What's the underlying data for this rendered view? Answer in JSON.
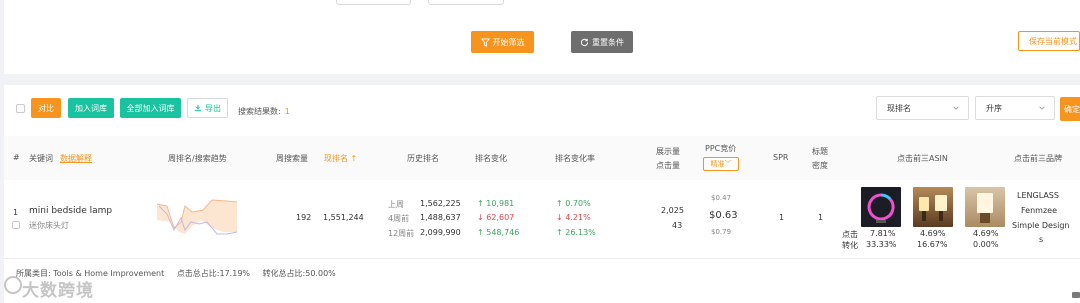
{
  "top": {
    "start_filter": "开始筛选",
    "reset": "重置条件",
    "save_template": "保存当前模式"
  },
  "toolbar": {
    "compare": "对比",
    "add_to_library": "加入词库",
    "add_all_to_library": "全部加入词库",
    "export": "导出",
    "result_label": "搜索结果数:",
    "result_count": "1",
    "sort_field": "现排名",
    "sort_order": "升序",
    "confirm": "确定"
  },
  "columns": {
    "index": "#",
    "keyword": "关键词",
    "data_explain": "数据解释",
    "weekly_trend": "周排名/搜索趋势",
    "weekly_search_volume": "周搜索量",
    "current_rank": "现排名",
    "history_rank": "历史排名",
    "rank_change": "排名变化",
    "rank_change_rate": "排名变化率",
    "impressions": "展示量",
    "clicks": "点击量",
    "ppc_bid": "PPC竞价",
    "ppc_mode": "精准",
    "spr": "SPR",
    "title_density_1": "标题",
    "title_density_2": "密度",
    "top3_asin": "点击前三ASIN",
    "top3_brand": "点击前三品牌"
  },
  "row": {
    "index": "1",
    "keyword": "mini bedside lamp",
    "keyword_cn": "迷你床头灯",
    "weekly_search_volume": "192",
    "current_rank": "1,551,244",
    "history": [
      {
        "label": "上周",
        "value": "1,562,225",
        "change": "10,981",
        "change_dir": "up",
        "rate": "0.70%",
        "rate_dir": "up"
      },
      {
        "label": "4周前",
        "value": "1,488,637",
        "change": "62,607",
        "change_dir": "down",
        "rate": "4.21%",
        "rate_dir": "down"
      },
      {
        "label": "12周前",
        "value": "2,099,990",
        "change": "548,746",
        "change_dir": "up",
        "rate": "26.13%",
        "rate_dir": "up"
      }
    ],
    "impressions": "2,025",
    "clicks": "43",
    "ppc_high": "$0.47",
    "ppc_mid": "$0.63",
    "ppc_low": "$0.79",
    "spr": "1",
    "title_density": "1",
    "asin_click_label": "点击",
    "asin_conv_label": "转化",
    "asins": [
      {
        "click": "7.81%",
        "conversion": "33.33%"
      },
      {
        "click": "4.69%",
        "conversion": "16.67%"
      },
      {
        "click": "4.69%",
        "conversion": "0.00%"
      }
    ],
    "brands_line1": "LENGLASS",
    "brands_line2": "Fenmzee",
    "brands_line3": "Simple Design",
    "brands_line4": "s"
  },
  "footer": {
    "category": "所属类目: Tools & Home Improvement",
    "click_share": "点击总占比:17.19%",
    "conversion_share": "转化总占比:50.00%"
  },
  "watermark": "大数跨境",
  "colors": {
    "accent_orange": "#f7941d",
    "teal": "#19c39f",
    "up_green": "#3ba55c",
    "down_red": "#e0494a"
  }
}
